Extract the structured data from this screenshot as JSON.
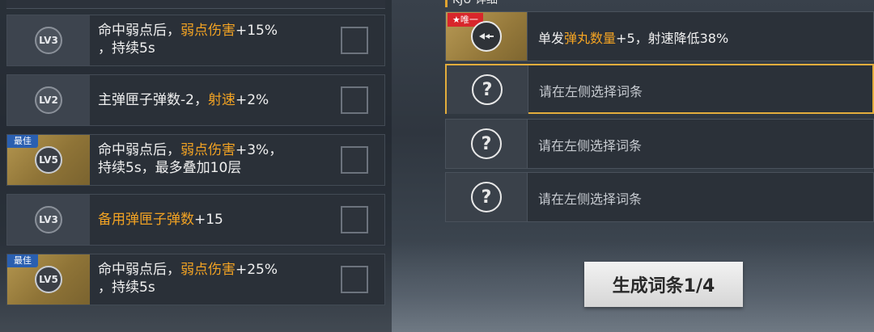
{
  "left": {
    "rows": [
      {
        "level": "LV3",
        "best": false,
        "parts": [
          {
            "t": "命中弱点后，",
            "hl": false
          },
          {
            "t": "弱点伤害",
            "hl": true
          },
          {
            "t": "+15%",
            "hl": false
          },
          {
            "t": "\n，持续5s",
            "hl": false
          }
        ]
      },
      {
        "level": "LV2",
        "best": false,
        "parts": [
          {
            "t": "主弹匣子弹数-2，",
            "hl": false
          },
          {
            "t": "射速",
            "hl": true
          },
          {
            "t": "+2%",
            "hl": false
          }
        ]
      },
      {
        "level": "LV5",
        "best": true,
        "parts": [
          {
            "t": "命中弱点后，",
            "hl": false
          },
          {
            "t": "弱点伤害",
            "hl": true
          },
          {
            "t": "+3%，\n持续5s，最多叠加10层",
            "hl": false
          }
        ]
      },
      {
        "level": "LV3",
        "best": false,
        "parts": [
          {
            "t": "备用弹匣子弹数",
            "hl": true
          },
          {
            "t": "+15",
            "hl": false
          }
        ]
      },
      {
        "level": "LV5",
        "best": true,
        "parts": [
          {
            "t": "命中弱点后，",
            "hl": false
          },
          {
            "t": "弱点伤害",
            "hl": true
          },
          {
            "t": "+25%",
            "hl": false
          },
          {
            "t": "\n，持续5s",
            "hl": false
          }
        ]
      }
    ],
    "best_label": "最佳"
  },
  "right": {
    "title": "KJU  详细",
    "slot1": {
      "unique_label": "★唯一",
      "text_parts": [
        {
          "t": "单发",
          "hl": false
        },
        {
          "t": "弹丸数量",
          "hl": true
        },
        {
          "t": "+5，射速降低38%",
          "hl": false
        }
      ]
    },
    "placeholder_icon": "?",
    "slot2_text": "请在左侧选择词条",
    "slot3_text": "请在左侧选择词条",
    "slot4_text": "请在左侧选择词条",
    "generate_button": "生成词条1/4"
  },
  "icons": {
    "filled_slot": "triple-arrow-icon",
    "empty_slot": "question-icon"
  },
  "colors": {
    "highlight": "#f3a323",
    "best_tag": "#2a5fb0",
    "unique_tag": "#d8262b",
    "selected_border": "#e3ad3c"
  }
}
